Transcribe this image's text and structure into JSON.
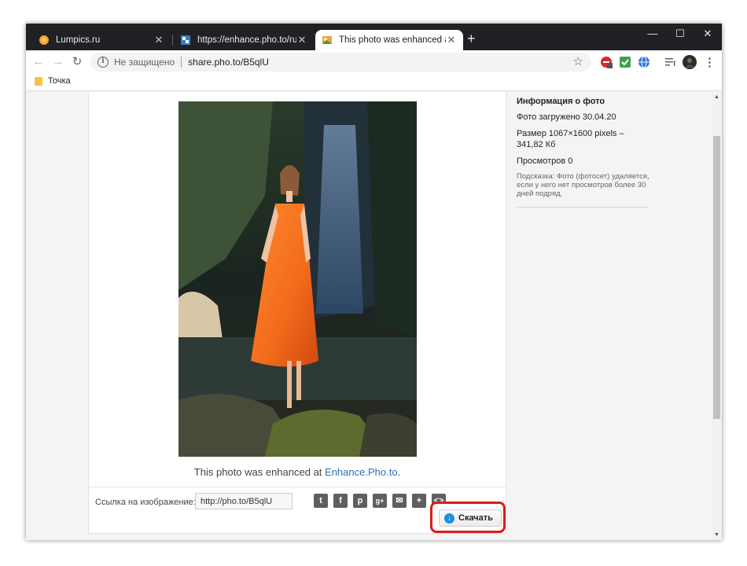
{
  "browser": {
    "tabs": [
      {
        "title": "Lumpics.ru"
      },
      {
        "title": "https://enhance.pho.to/ru/"
      },
      {
        "title": "This photo was enhanced at Enha"
      }
    ],
    "omnibox": {
      "security": "Не защищено",
      "url": "share.pho.to/B5qlU"
    },
    "bookmark": "Точка"
  },
  "photo_card": {
    "caption_prefix": "This photo was enhanced at",
    "caption_link": "Enhance.Pho.to",
    "caption_suffix": ".",
    "share_label": "Ссылка на изображение:",
    "share_url": "http://pho.to/B5qlU",
    "download_label": "Скачать"
  },
  "info_panel": {
    "title": "Информация о фото",
    "uploaded": "Фото загружено 30.04.20",
    "size": "Размер 1067×1600 pixels – 341,82 Кб",
    "views": "Просмотров 0",
    "hint": "Подсказка: Фото (фотосет) удаляется, если у него нет просмотров более 30 дней подряд."
  },
  "colors": {
    "highlight": "#e01a1a",
    "link": "#2e6db4",
    "dress": "#f26a1b"
  }
}
